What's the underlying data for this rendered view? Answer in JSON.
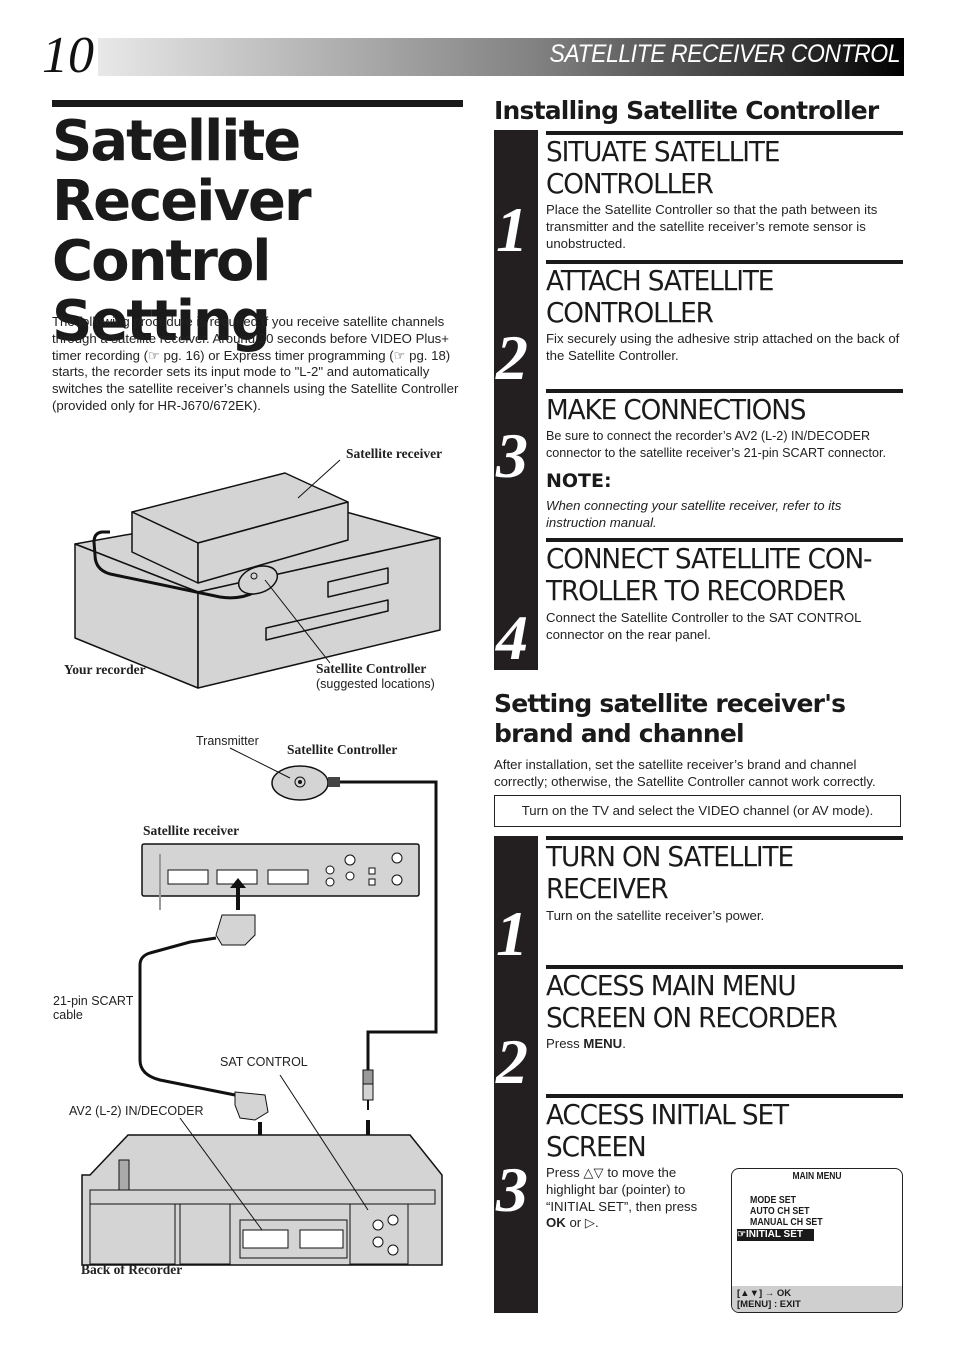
{
  "header": {
    "page_number": "10",
    "section_title": "SATELLITE RECEIVER CONTROL"
  },
  "left": {
    "title_lines": [
      "Satellite",
      "Receiver",
      "Control Setting"
    ],
    "intro_parts": {
      "p1": "The following procedure is required if you receive satellite channels through a satellite receiver. Around 20 seconds before VIDEO Plus+ timer recording (",
      "ref1_icon": "☞",
      "p2": " pg. 16) or Express timer programming (",
      "ref2_icon": "☞",
      "p3": " pg. 18) starts, the recorder sets its input mode to \"L-2\" and automatically switches the satellite receiver’s channels using the Satellite Controller (provided only for HR-J670/672EK)."
    },
    "diagram1": {
      "label_receiver": "Satellite receiver",
      "label_recorder": "Your recorder",
      "label_controller": "Satellite Controller",
      "label_controller_sub": "(suggested locations)"
    },
    "diagram2": {
      "label_transmitter": "Transmitter",
      "label_controller": "Satellite Controller",
      "label_receiver": "Satellite receiver",
      "label_scart_1": "21-pin SCART",
      "label_scart_2": "cable",
      "label_sat_control": "SAT CONTROL",
      "label_av2": "AV2 (L-2) IN/DECODER",
      "label_back": "Back of  Recorder"
    }
  },
  "installing": {
    "heading": "Installing Satellite Controller",
    "steps": [
      {
        "number": "1",
        "title_lines": [
          "SITUATE SATELLITE",
          "CONTROLLER"
        ],
        "text": "Place the Satellite Controller so that the path between its transmitter and the satellite receiver’s remote sensor is unobstructed."
      },
      {
        "number": "2",
        "title_lines": [
          "ATTACH SATELLITE",
          "CONTROLLER"
        ],
        "text": "Fix securely using the adhesive strip attached on the back of the Satellite Controller."
      },
      {
        "number": "3",
        "title_lines": [
          "MAKE CONNECTIONS"
        ],
        "text": "Be sure to connect the recorder’s AV2 (L-2) IN/DECODER connector to the satellite receiver’s 21-pin SCART connector.",
        "note_heading": "NOTE:",
        "note_text": "When connecting your satellite receiver, refer to its instruction manual."
      },
      {
        "number": "4",
        "title_lines": [
          "CONNECT SATELLITE CON-",
          "TROLLER TO RECORDER"
        ],
        "text": "Connect the Satellite Controller to the SAT CONTROL connector on the rear panel."
      }
    ]
  },
  "setting": {
    "heading_lines": [
      "Setting satellite receiver's",
      "brand and channel"
    ],
    "intro": "After installation, set the satellite receiver’s brand and channel correctly; otherwise, the Satellite Controller cannot work correctly.",
    "box_text": "Turn on the TV and select the VIDEO channel (or AV mode).",
    "steps": [
      {
        "number": "1",
        "title_lines": [
          "TURN ON SATELLITE",
          "RECEIVER"
        ],
        "text": "Turn on the satellite receiver’s power."
      },
      {
        "number": "2",
        "title_lines": [
          "ACCESS MAIN MENU",
          "SCREEN ON RECORDER"
        ],
        "text_prefix": "Press ",
        "text_bold": "MENU",
        "text_suffix": "."
      },
      {
        "number": "3",
        "title_lines": [
          "ACCESS INITIAL SET",
          "SCREEN"
        ],
        "text_lines": [
          "Press △▽ to move the",
          "highlight bar (pointer) to",
          "“INITIAL SET”, then press"
        ],
        "text_bold": "OK",
        "text_suffix": " or ▷."
      }
    ]
  },
  "osd_menu": {
    "title": "MAIN MENU",
    "items": [
      "MODE SET",
      "AUTO CH SET",
      "MANUAL CH SET"
    ],
    "selected_item": "INITIAL SET",
    "pointer_icon": "☞",
    "footer_line1": "[▲▼] → OK",
    "footer_line2": "[MENU] : EXIT"
  }
}
